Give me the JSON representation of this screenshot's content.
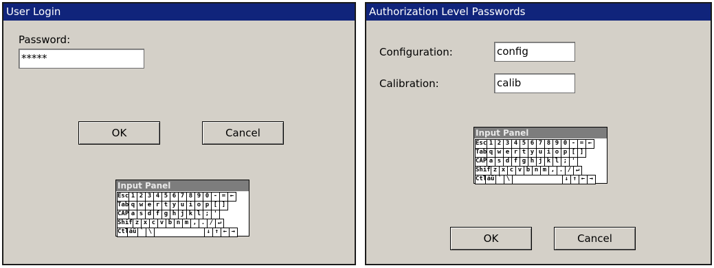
{
  "login_dialog": {
    "title": "User Login",
    "password_label": "Password:",
    "password_value": "*****",
    "ok_label": "OK",
    "cancel_label": "Cancel"
  },
  "auth_dialog": {
    "title": "Authorization Level Passwords",
    "configuration_label": "Configuration:",
    "configuration_value": "config",
    "calibration_label": "Calibration:",
    "calibration_value": "calib",
    "ok_label": "OK",
    "cancel_label": "Cancel"
  },
  "input_panel": {
    "title": "Input Panel",
    "rows": [
      [
        "Esc",
        "1",
        "2",
        "3",
        "4",
        "5",
        "6",
        "7",
        "8",
        "9",
        "0",
        "-",
        "=",
        "←"
      ],
      [
        "Tab",
        "q",
        "w",
        "e",
        "r",
        "t",
        "y",
        "u",
        "i",
        "o",
        "p",
        "[",
        "]"
      ],
      [
        "CAP",
        "a",
        "s",
        "d",
        "f",
        "g",
        "h",
        "j",
        "k",
        "l",
        ";",
        "'"
      ],
      [
        "Shift",
        "z",
        "x",
        "c",
        "v",
        "b",
        "n",
        "m",
        ",",
        ".",
        "/",
        "↵"
      ],
      [
        "Ctl",
        "áü",
        "`",
        "\\",
        "",
        "↓",
        "↑",
        "←",
        "→"
      ]
    ]
  }
}
